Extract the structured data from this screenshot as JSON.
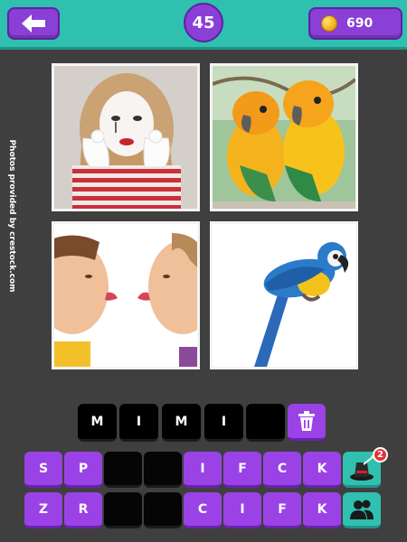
{
  "header": {
    "back_icon": "arrow-left-icon",
    "level": "45",
    "coin_icon": "gold-coin-icon",
    "coins": "690"
  },
  "credit": "Photos provided by crestock.com",
  "photos": [
    {
      "subject": "mime-woman"
    },
    {
      "subject": "yellow-parakeets"
    },
    {
      "subject": "children-sticking-tongues"
    },
    {
      "subject": "blue-macaw"
    }
  ],
  "answer": {
    "letters": [
      "M",
      "I",
      "M",
      "I",
      "",
      ""
    ]
  },
  "clear_button_icon": "trash-icon",
  "keyboard": {
    "row1": [
      "S",
      "P",
      "",
      "",
      "I",
      "F",
      "C",
      "K"
    ],
    "row2": [
      "Z",
      "R",
      "",
      "",
      "C",
      "I",
      "F",
      "K"
    ]
  },
  "hints": {
    "magic_icon": "magic-hat-icon",
    "magic_badge": "2",
    "friends_icon": "friends-icon"
  },
  "colors": {
    "header_bg": "#2fc0b0",
    "accent_purple": "#9a42e6",
    "background": "#3f3f3f"
  }
}
